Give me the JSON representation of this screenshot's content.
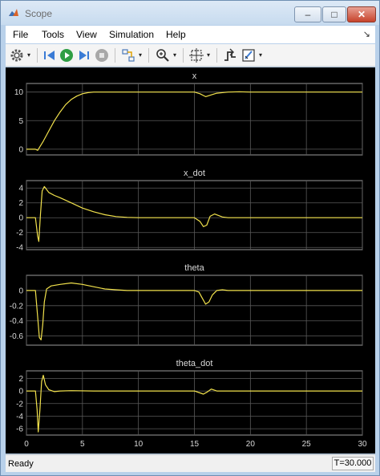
{
  "window": {
    "title": "Scope",
    "minimize_glyph": "–",
    "maximize_glyph": "□",
    "close_glyph": "✕"
  },
  "menu": {
    "items": [
      "File",
      "Tools",
      "View",
      "Simulation",
      "Help"
    ],
    "expand_glyph": "↘"
  },
  "toolbar": {
    "icons": [
      "gear-icon",
      "step-back-icon",
      "run-icon",
      "step-forward-icon",
      "stop-icon",
      "highlight-icon",
      "zoom-icon",
      "fit-axes-icon",
      "triggers-icon",
      "cursor-measurements-icon"
    ],
    "dropdown_glyph": "▾"
  },
  "status": {
    "text": "Ready",
    "time": "T=30.000"
  },
  "colors": {
    "signal": "#f2e24c",
    "grid": "#5a5a5a",
    "axis_text": "#d9d9d9",
    "plot_background": "#000000"
  },
  "chart_data": [
    {
      "type": "line",
      "title": "x",
      "xlim": [
        0,
        30
      ],
      "ylim": [
        -1,
        11.5
      ],
      "yticks": [
        0,
        5,
        10
      ],
      "xticks": [
        0,
        5,
        10,
        15,
        20,
        25,
        30
      ],
      "show_x_tick_labels": false,
      "grid": true,
      "series": [
        {
          "x": [
            0,
            0.8,
            1.0,
            1.5,
            2,
            2.5,
            3,
            3.5,
            4,
            4.5,
            5,
            5.5,
            6,
            7,
            8,
            10,
            15,
            15.5,
            16,
            16.5,
            17,
            18,
            19,
            20,
            25,
            30
          ],
          "y": [
            0,
            0,
            -0.2,
            1.4,
            3.2,
            5.0,
            6.5,
            7.8,
            8.7,
            9.3,
            9.7,
            9.9,
            10,
            10,
            10,
            10,
            10,
            9.7,
            9.2,
            9.5,
            9.8,
            10,
            10.05,
            10,
            10,
            10
          ]
        }
      ]
    },
    {
      "type": "line",
      "title": "x_dot",
      "xlim": [
        0,
        30
      ],
      "ylim": [
        -4.3,
        5
      ],
      "yticks": [
        -4,
        -2,
        0,
        2,
        4
      ],
      "xticks": [
        0,
        5,
        10,
        15,
        20,
        25,
        30
      ],
      "show_x_tick_labels": false,
      "grid": true,
      "series": [
        {
          "x": [
            0,
            0.8,
            1.0,
            1.1,
            1.25,
            1.4,
            1.6,
            2,
            2.5,
            3,
            4,
            5,
            6,
            7,
            8,
            9,
            10,
            15,
            15.5,
            15.8,
            16.1,
            16.4,
            16.8,
            17.5,
            18,
            30
          ],
          "y": [
            0,
            0,
            -2.5,
            -3.2,
            0.5,
            3.6,
            4.2,
            3.4,
            3.0,
            2.7,
            2.0,
            1.3,
            0.8,
            0.4,
            0.15,
            0.05,
            0,
            0,
            -0.5,
            -1.2,
            -1.0,
            0.2,
            0.5,
            0.1,
            0,
            0
          ]
        }
      ]
    },
    {
      "type": "line",
      "title": "theta",
      "xlim": [
        0,
        30
      ],
      "ylim": [
        -0.72,
        0.2
      ],
      "yticks": [
        -0.6,
        -0.4,
        -0.2,
        0
      ],
      "xticks": [
        0,
        5,
        10,
        15,
        20,
        25,
        30
      ],
      "show_x_tick_labels": false,
      "grid": true,
      "series": [
        {
          "x": [
            0,
            0.8,
            1.0,
            1.15,
            1.3,
            1.45,
            1.6,
            1.8,
            2.2,
            3,
            4,
            5,
            6,
            7,
            8,
            9,
            15,
            15.4,
            15.7,
            16.0,
            16.3,
            16.6,
            17,
            17.5,
            18,
            30
          ],
          "y": [
            0,
            0,
            -0.35,
            -0.62,
            -0.65,
            -0.45,
            -0.15,
            0.02,
            0.06,
            0.08,
            0.1,
            0.08,
            0.05,
            0.02,
            0.01,
            0,
            0,
            -0.02,
            -0.1,
            -0.18,
            -0.15,
            -0.06,
            0,
            0.01,
            0,
            0
          ]
        }
      ]
    },
    {
      "type": "line",
      "title": "theta_dot",
      "xlim": [
        0,
        30
      ],
      "ylim": [
        -7,
        3.2
      ],
      "yticks": [
        -6,
        -4,
        -2,
        0,
        2
      ],
      "xticks": [
        0,
        5,
        10,
        15,
        20,
        25,
        30
      ],
      "xticklabels": [
        "0",
        "5",
        "10",
        "15",
        "20",
        "25",
        "30"
      ],
      "show_x_tick_labels": true,
      "grid": true,
      "series": [
        {
          "x": [
            0,
            0.8,
            0.95,
            1.05,
            1.2,
            1.35,
            1.5,
            1.7,
            2.0,
            2.5,
            3,
            4,
            6,
            15,
            15.5,
            15.8,
            16.1,
            16.5,
            17,
            30
          ],
          "y": [
            0,
            0,
            -3,
            -6.5,
            -3,
            1.5,
            2.5,
            1.0,
            0.2,
            -0.1,
            0,
            0.05,
            0,
            0,
            -0.3,
            -0.5,
            -0.2,
            0.3,
            0,
            0
          ]
        }
      ]
    }
  ]
}
